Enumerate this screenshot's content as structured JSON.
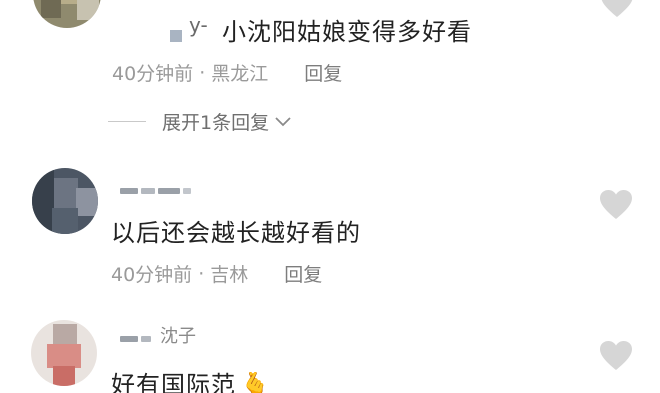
{
  "comment1": {
    "name_prefix": "y-",
    "text": "小沈阳姑娘变得多好看",
    "time": "40分钟前",
    "location": "黑龙江",
    "reply_label": "回复",
    "expand_label": "展开1条回复"
  },
  "comment2": {
    "text": "以后还会越长越好看的",
    "time": "40分钟前",
    "location": "吉林",
    "reply_label": "回复"
  },
  "comment3": {
    "name_partial": "沈子",
    "text": "好有国际范",
    "emoji": "🫰"
  },
  "separator": "·",
  "colors": {
    "text": "#222222",
    "meta": "#9a9a9a",
    "heart": "#d6d6d6"
  }
}
